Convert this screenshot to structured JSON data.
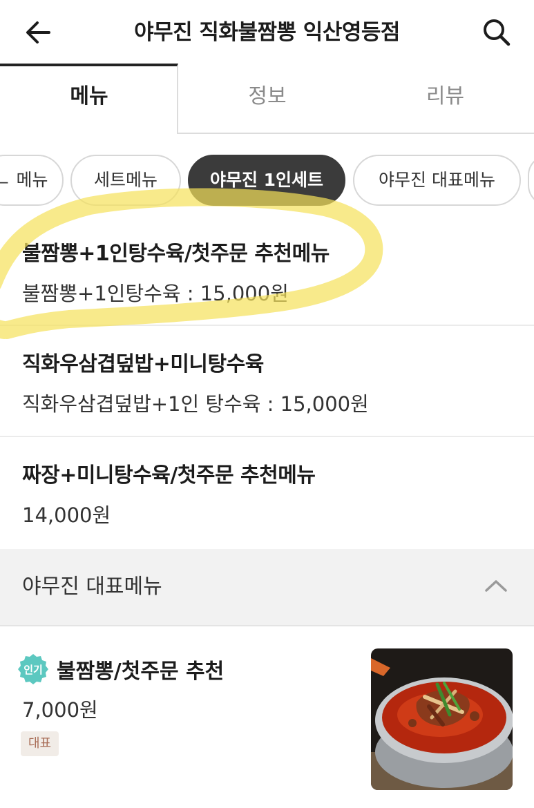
{
  "header": {
    "title": "야무진 직화불짬뽕 익산영등점",
    "back_icon": "arrow-left-icon",
    "search_icon": "search-icon"
  },
  "tabs": [
    {
      "label": "메뉴",
      "active": true
    },
    {
      "label": "정보",
      "active": false
    },
    {
      "label": "리뷰",
      "active": false
    }
  ],
  "categories": [
    {
      "label": "ㄴ 메뉴",
      "active": false
    },
    {
      "label": "세트메뉴",
      "active": false
    },
    {
      "label": "야무진 1인세트",
      "active": true
    },
    {
      "label": "야무진 대표메뉴",
      "active": false
    }
  ],
  "menu_items": [
    {
      "name": "불짬뽕+1인탕수육/첫주문 추천메뉴",
      "desc": "불짬뽕+1인탕수육 : 15,000원"
    },
    {
      "name": "직화우삼겹덮밥+미니탕수육",
      "desc": "직화우삼겹덮밥+1인 탕수육 : 15,000원"
    },
    {
      "name": "짜장+미니탕수육/첫주문 추천메뉴",
      "desc": "14,000원"
    }
  ],
  "section": {
    "title": "야무진 대표메뉴",
    "chevron_icon": "chevron-up-icon"
  },
  "featured": {
    "badge": "인기",
    "name": "불짬뽕/첫주문 추천",
    "price": "7,000원",
    "tag": "대표"
  },
  "colors": {
    "active_chip": "#3b3b3b",
    "badge": "#5cc8c0",
    "tag_bg": "#f1ece7",
    "tag_text": "#a86b55",
    "highlight": "#f5e15a"
  }
}
